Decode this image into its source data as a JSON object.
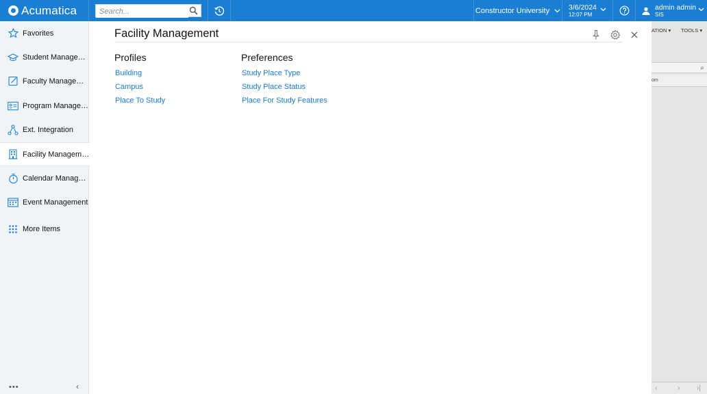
{
  "topbar": {
    "logo": "Acumatica",
    "search_placeholder": "Search...",
    "company": "Constructor University",
    "date": "3/6/2024",
    "time": "12:07 PM",
    "user_name": "admin admin",
    "user_branch": "SIS",
    "accent": "#1a7fd3"
  },
  "sidebar": {
    "items": [
      {
        "label": "Favorites",
        "icon": "star-icon"
      },
      {
        "label": "Student Management",
        "icon": "graduation-cap-icon"
      },
      {
        "label": "Faculty Management",
        "icon": "edit-icon"
      },
      {
        "label": "Program Management",
        "icon": "id-card-icon"
      },
      {
        "label": "Ext. Integration",
        "icon": "network-icon"
      },
      {
        "label": "Facility Management",
        "icon": "building-icon",
        "active": true
      },
      {
        "label": "Calendar Management",
        "icon": "stopwatch-icon"
      },
      {
        "label": "Event Management",
        "icon": "calendar-grid-icon"
      },
      {
        "label": "More Items",
        "icon": "grid-dots-icon"
      }
    ],
    "bottom_dots": "•••",
    "collapse": "‹"
  },
  "background_screen": {
    "toolbar_left": "ATION",
    "toolbar_tools": "TOOLS",
    "column_fragment": "om"
  },
  "panel": {
    "title": "Facility Management",
    "columns": [
      {
        "heading": "Profiles",
        "links": [
          "Building",
          "Campus",
          "Place To Study"
        ]
      },
      {
        "heading": "Preferences",
        "links": [
          "Study Place Type",
          "Study Place Status",
          "Place For Study Features"
        ]
      }
    ],
    "link_color": "#1a7bd1"
  }
}
